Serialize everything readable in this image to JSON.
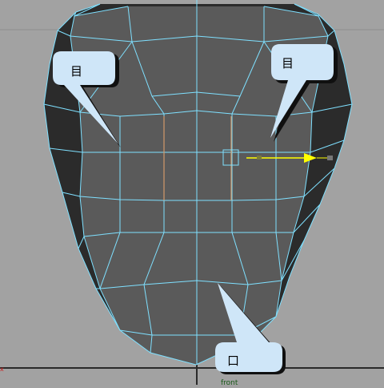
{
  "viewport": {
    "view_label": "front",
    "axis_marker": "x",
    "colors": {
      "background": "#a2a2a2",
      "grid_line": "#8c8c8c",
      "axis_line": "#2a2a2a",
      "mesh_face": "#5a5a5a",
      "mesh_side": "#2b2b2b",
      "wireframe": "#7fe0ff",
      "selected_edge": "#d19a6a",
      "manipulator": "#ffff00",
      "callout_fill": "#cfe6f8",
      "callout_shadow": "#101010",
      "view_label_color": "#1a5a1a",
      "axis_marker_color": "#cc2222"
    }
  },
  "annotations": [
    {
      "id": "left-eye",
      "text": "目"
    },
    {
      "id": "right-eye",
      "text": "目"
    },
    {
      "id": "mouth",
      "text": "口"
    }
  ]
}
